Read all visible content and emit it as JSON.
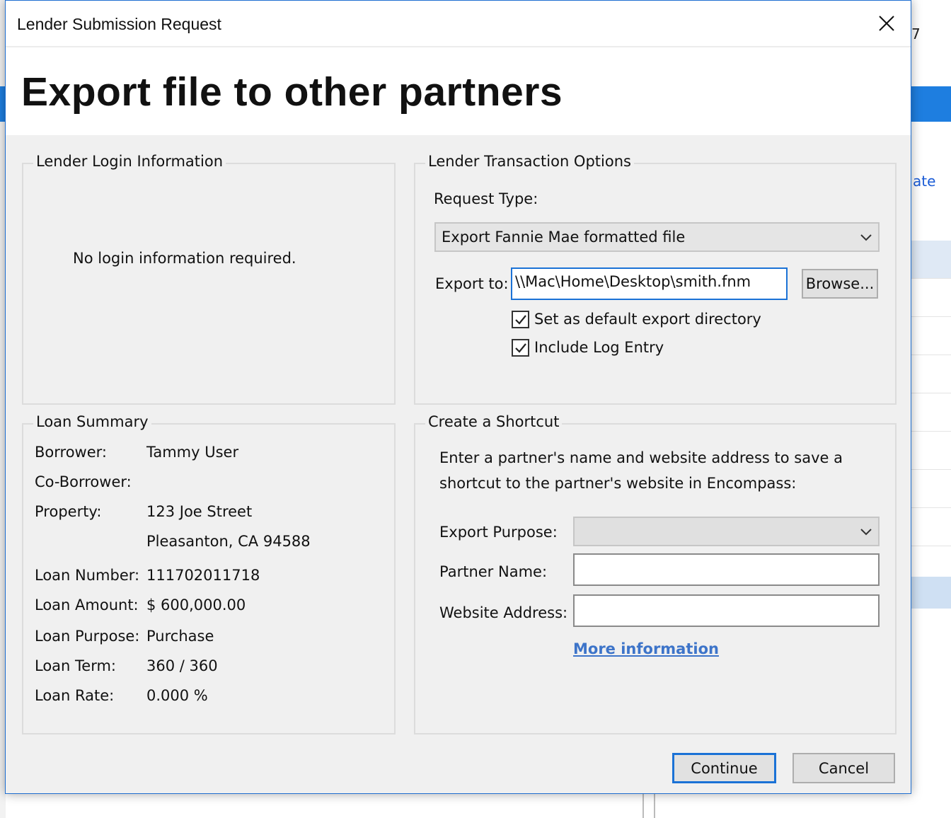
{
  "background": {
    "partial_link": "ate",
    "partial_number": "7"
  },
  "dialog": {
    "title": "Lender Submission Request",
    "close_icon": "close-icon",
    "banner_title": "Export file to other partners",
    "login_group": {
      "legend": "Lender Login Information",
      "message": "No login information required."
    },
    "transaction_group": {
      "legend": "Lender Transaction Options",
      "request_type_label": "Request Type:",
      "request_type_value": "Export Fannie Mae formatted file",
      "export_to_label": "Export to:",
      "export_to_value": "\\\\Mac\\Home\\Desktop\\smith.fnm",
      "browse_label": "Browse...",
      "default_dir_label": "Set as default export directory",
      "default_dir_checked": true,
      "log_entry_label": "Include Log Entry",
      "log_entry_checked": true
    },
    "loan_summary": {
      "legend": "Loan Summary",
      "rows": [
        {
          "label": "Borrower:",
          "value": "Tammy User"
        },
        {
          "label": "Co-Borrower:",
          "value": ""
        },
        {
          "label": "Property:",
          "value": "123 Joe Street"
        },
        {
          "label": "",
          "value": "Pleasanton, CA 94588"
        },
        {
          "label": "Loan Number:",
          "value": "111702011718"
        },
        {
          "label": "Loan Amount:",
          "value": "$ 600,000.00"
        },
        {
          "label": "Loan Purpose:",
          "value": "Purchase"
        },
        {
          "label": "Loan Term:",
          "value": "360 / 360"
        },
        {
          "label": "Loan Rate:",
          "value": "0.000 %"
        }
      ]
    },
    "shortcut_group": {
      "legend": "Create a Shortcut",
      "description_line1": "Enter a partner's name and website address to save a",
      "description_line2": "shortcut to the partner's website in Encompass:",
      "export_purpose_label": "Export Purpose:",
      "export_purpose_value": "",
      "partner_name_label": "Partner Name:",
      "partner_name_value": "",
      "website_label": "Website Address:",
      "website_value": "",
      "more_info_link": "More information"
    },
    "continue_label": "Continue",
    "cancel_label": "Cancel"
  }
}
